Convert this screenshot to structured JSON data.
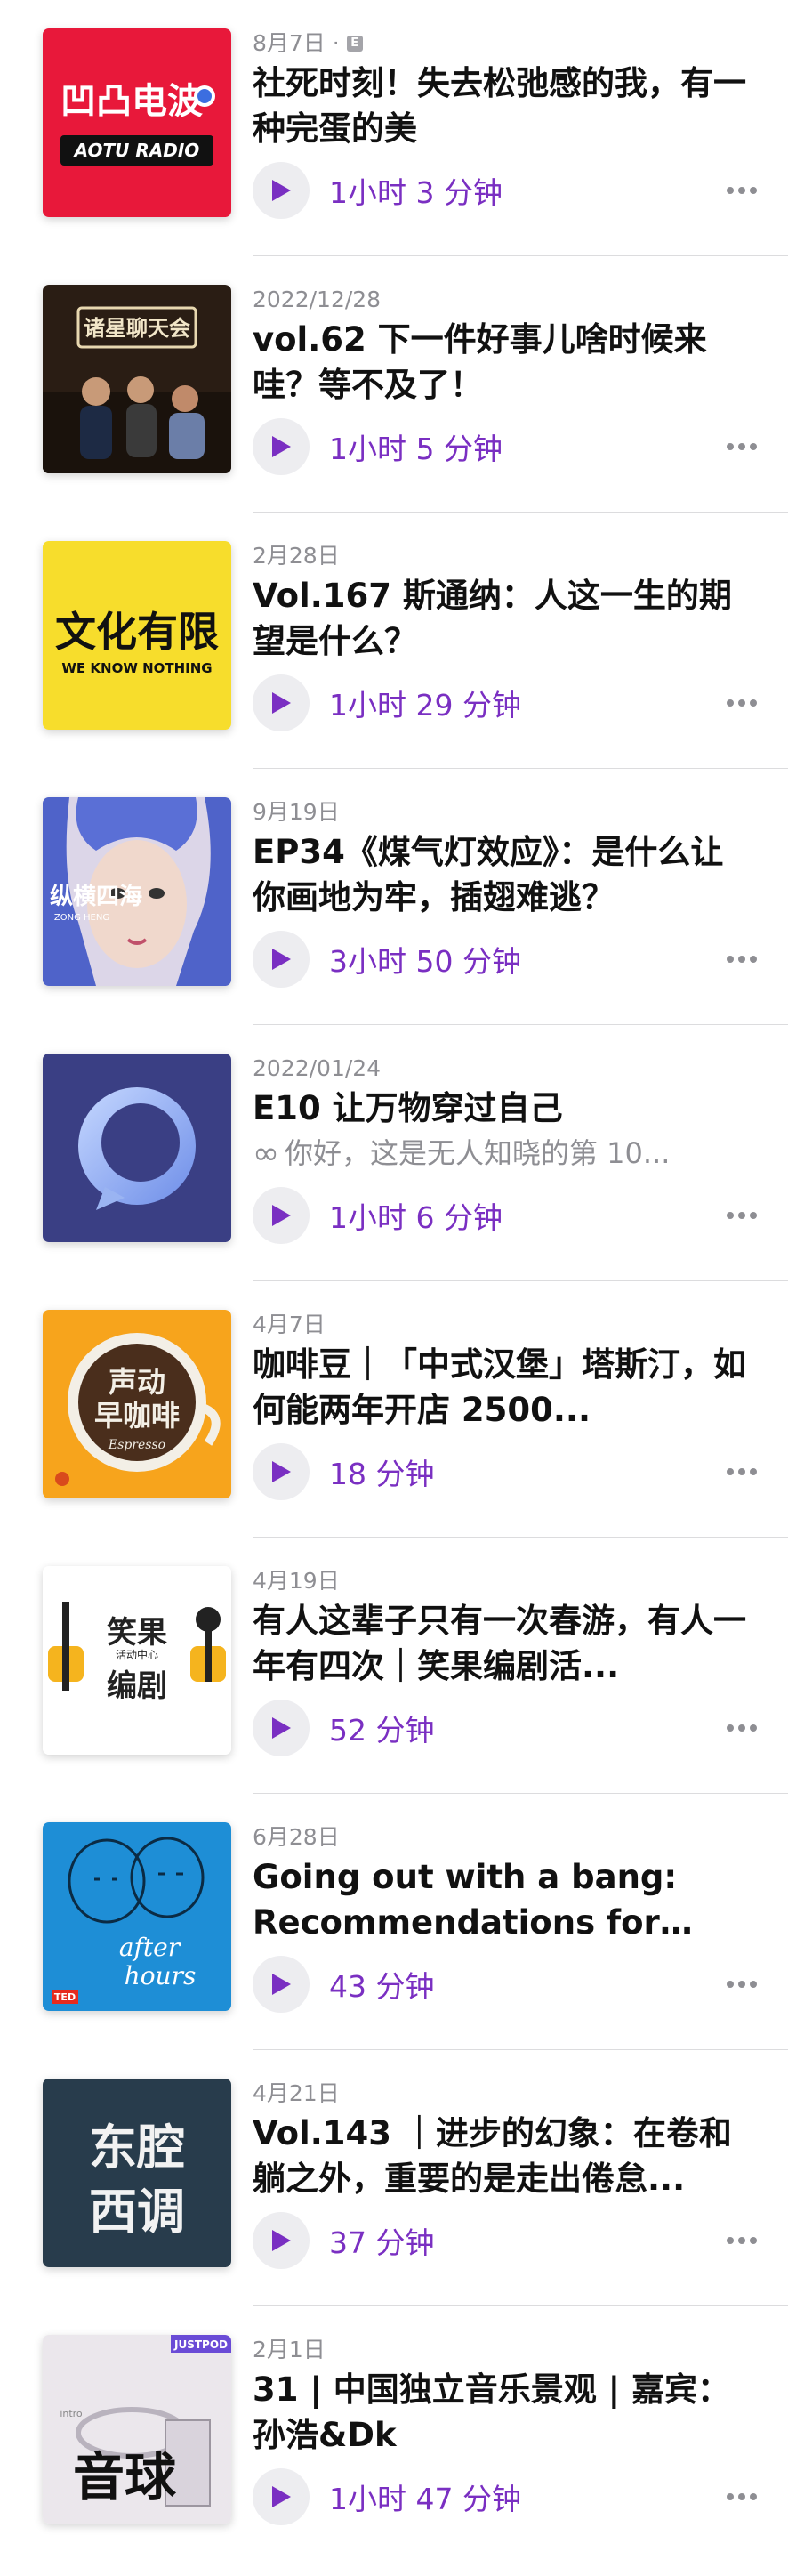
{
  "colors": {
    "accent": "#7a2fc2",
    "secondary_text": "#8e8e93",
    "title_text": "#111111",
    "play_bg": "#ededf0"
  },
  "episodes": [
    {
      "date": "8月7日 ·",
      "explicit": "E",
      "title": "社死时刻！失去松弛感的我，有一种完蛋的美",
      "duration": "1小时 3 分钟",
      "art_text_1": "凹凸电波",
      "art_text_2": "AOTU RADIO"
    },
    {
      "date": "2022/12/28",
      "title": "vol.62 下一件好事儿啥时候来哇？等不及了！",
      "duration": "1小时 5 分钟",
      "art_text_1": "诸星聊天会"
    },
    {
      "date": "2月28日",
      "title": "Vol.167 斯通纳：人这一生的期望是什么？",
      "duration": "1小时 29 分钟",
      "art_text_1": "文化有限",
      "art_text_2": "WE KNOW NOTHING"
    },
    {
      "date": "9月19日",
      "title": "EP34《煤气灯效应》：是什么让你画地为牢，插翅难逃？",
      "duration": "3小时 50 分钟",
      "art_text_1": "纵横四海",
      "art_text_2": "ZONG HENG"
    },
    {
      "date": "2022/01/24",
      "title": "E10 让万物穿过自己",
      "description": "你好，这是无人知晓的第 10...",
      "duration": "1小时 6 分钟"
    },
    {
      "date": "4月7日",
      "title": "咖啡豆｜「中式汉堡」塔斯汀，如何能两年开店 2500...",
      "duration": "18 分钟",
      "art_text_1": "声动",
      "art_text_2": "早咖啡",
      "art_text_3": "Espresso"
    },
    {
      "date": "4月19日",
      "title": "有人这辈子只有一次春游，有人一年有四次｜笑果编剧活...",
      "duration": "52 分钟",
      "art_text_1": "笑果",
      "art_text_2": "编剧",
      "art_text_3": "活动中心"
    },
    {
      "date": "6月28日",
      "title": "Going out with a bang: Recommendations for this...",
      "duration": "43 分钟",
      "art_text_1": "after",
      "art_text_2": "hours",
      "art_text_3": "TED"
    },
    {
      "date": "4月21日",
      "title": "Vol.143 ｜进步的幻象：在卷和躺之外，重要的是走出倦怠...",
      "duration": "37 分钟",
      "art_text_1": "东腔",
      "art_text_2": "西调"
    },
    {
      "date": "2月1日",
      "title": "31 | 中国独立音乐景观 | 嘉宾：孙浩&Dk",
      "duration": "1小时 47 分钟",
      "art_text_1": "音球",
      "art_text_2": "JUSTPOD",
      "art_text_3": "intro"
    }
  ]
}
